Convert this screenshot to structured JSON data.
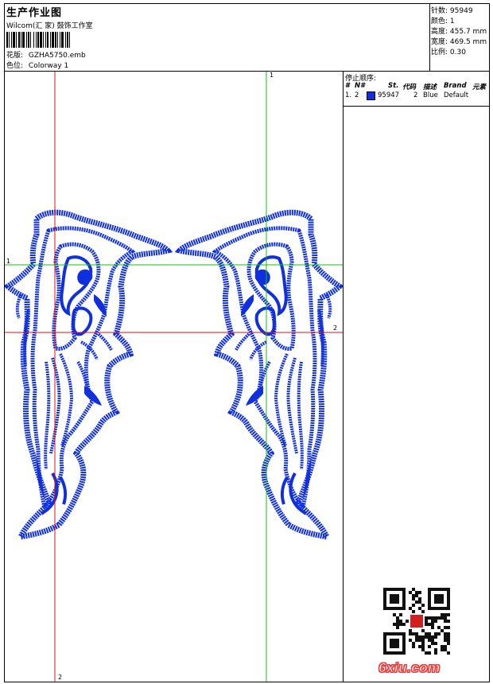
{
  "header": {
    "title": "生产作业图",
    "company": "Wilcom(汇 家) 鼓饰工作室",
    "design_label": "花版:",
    "design_file": "GZHA5750.emb",
    "color_label": "色位:",
    "colorway": "Colorway 1"
  },
  "stats": {
    "stitches_label": "针数:",
    "stitches": "95949",
    "colors_label": "颜色:",
    "colors": "1",
    "height_label": "高度:",
    "height": "455.7 mm",
    "width_label": "宽度:",
    "width": "469.5 mm",
    "scale_label": "比例:",
    "scale": "0.30"
  },
  "stop_sequence": {
    "label": "停止顺序:",
    "columns": [
      "#",
      "N#",
      "St.",
      "代码",
      "描述",
      "Brand",
      "元素"
    ],
    "rows": [
      {
        "index": "1.",
        "needle": "2",
        "stitches": "95947",
        "code": "2",
        "description": "Blue",
        "brand": "Default",
        "swatch_color": "#1030e0"
      }
    ]
  },
  "guides": {
    "v_top": "1",
    "h_left": "1",
    "h_right": "2",
    "v_bottom": "2"
  },
  "watermark": {
    "site": "6xiu.com"
  },
  "colors": {
    "thread": "#1030e0",
    "guide_red": "#e01010",
    "guide_green": "#10c010"
  }
}
